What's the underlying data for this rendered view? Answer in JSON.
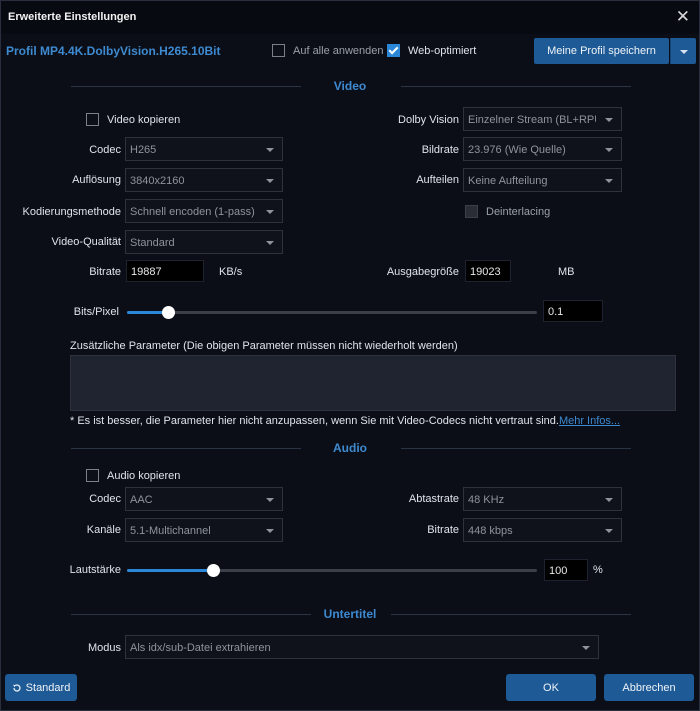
{
  "window": {
    "title": "Erweiterte Einstellungen",
    "close_glyph": "✕"
  },
  "header": {
    "profile_name": "Profil MP4.4K.DolbyVision.H265.10Bit",
    "apply_all_label": "Auf alle anwenden",
    "apply_all_checked": false,
    "web_optimized_label": "Web-optimiert",
    "web_optimized_checked": true,
    "save_profile_label": "Meine Profil speichern"
  },
  "video": {
    "section_title": "Video",
    "copy_video_label": "Video kopieren",
    "copy_video_checked": false,
    "codec_label": "Codec",
    "codec_value": "H265",
    "resolution_label": "Auflösung",
    "resolution_value": "3840x2160",
    "encoding_method_label": "Kodierungsmethode",
    "encoding_method_value": "Schnell encoden (1-pass)",
    "quality_label": "Video-Qualität",
    "quality_value": "Standard",
    "dolby_label": "Dolby Vision",
    "dolby_value": "Einzelner Stream (BL+RPU",
    "framerate_label": "Bildrate",
    "framerate_value": "23.976 (Wie Quelle)",
    "split_label": "Aufteilen",
    "split_value": "Keine Aufteilung",
    "deinterlacing_label": "Deinterlacing",
    "deinterlacing_checked": false,
    "bitrate_label": "Bitrate",
    "bitrate_value": "19887",
    "bitrate_unit": "KB/s",
    "output_size_label": "Ausgabegröße",
    "output_size_value": "19023",
    "output_size_unit": "MB",
    "bits_pixel_label": "Bits/Pixel",
    "bits_pixel_value": "0.1",
    "bits_pixel_fraction": 0.1,
    "extra_params_label": "Zusätzliche Parameter (Die obigen Parameter müssen nicht wiederholt werden)",
    "extra_params_value": "",
    "note_text": "* Es ist besser, die Parameter hier nicht anzupassen, wenn Sie mit Video-Codecs nicht vertraut sind.",
    "more_info_link": "Mehr Infos..."
  },
  "audio": {
    "section_title": "Audio",
    "copy_audio_label": "Audio kopieren",
    "copy_audio_checked": false,
    "codec_label": "Codec",
    "codec_value": "AAC",
    "channels_label": "Kanäle",
    "channels_value": "5.1-Multichannel",
    "samplerate_label": "Abtastrate",
    "samplerate_value": "48 KHz",
    "bitrate_label": "Bitrate",
    "bitrate_value": "448 kbps",
    "volume_label": "Lautstärke",
    "volume_value": "100",
    "volume_unit": "%",
    "volume_fraction": 0.21
  },
  "subtitle": {
    "section_title": "Untertitel",
    "mode_label": "Modus",
    "mode_value": "Als idx/sub-Datei extrahieren"
  },
  "footer": {
    "default_label": "Standard",
    "ok_label": "OK",
    "cancel_label": "Abbrechen"
  },
  "colors": {
    "accent": "#2b87d8",
    "title_blue": "#3e8ad0",
    "button": "#1e5a96"
  }
}
